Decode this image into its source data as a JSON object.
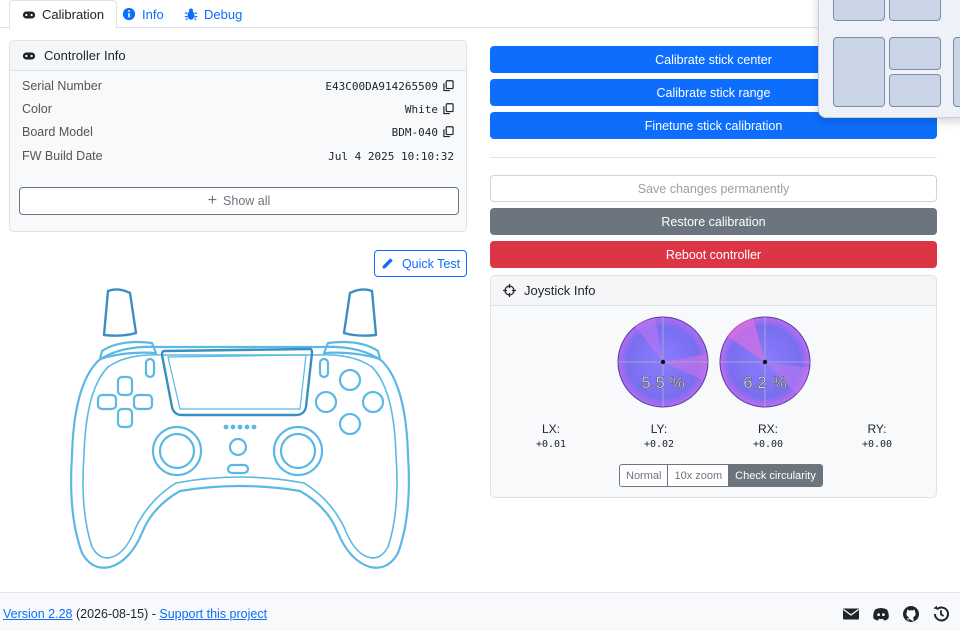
{
  "tabs": [
    {
      "label": "Calibration",
      "icon": "gamepad-icon"
    },
    {
      "label": "Info",
      "icon": "info-icon"
    },
    {
      "label": "Debug",
      "icon": "bug-icon"
    }
  ],
  "controller_info": {
    "title": "Controller Info",
    "rows": [
      {
        "label": "Serial Number",
        "value": "E43C00DA914265509",
        "copy": true
      },
      {
        "label": "Color",
        "value": "White",
        "copy": true
      },
      {
        "label": "Board Model",
        "value": "BDM-040",
        "copy": true
      },
      {
        "label": "FW Build Date",
        "value": "Jul 4 2025 10:10:32",
        "copy": false
      }
    ],
    "show_all_label": "Show all"
  },
  "quick_test_label": "Quick Test",
  "actions": {
    "calibrate_center": "Calibrate stick center",
    "calibrate_range": "Calibrate stick range",
    "finetune": "Finetune stick calibration",
    "save": "Save changes permanently",
    "restore": "Restore calibration",
    "reboot": "Reboot controller"
  },
  "joystick_info": {
    "title": "Joystick Info",
    "left_percent": "5.5 %",
    "right_percent": "6.2 %",
    "axes": [
      {
        "label": "LX:",
        "value": "+0.01"
      },
      {
        "label": "LY:",
        "value": "+0.02"
      },
      {
        "label": "RX:",
        "value": "+0.00"
      },
      {
        "label": "RY:",
        "value": "+0.00"
      }
    ],
    "modes": [
      "Normal",
      "10x zoom",
      "Check circularity"
    ],
    "active_mode": "Check circularity"
  },
  "footer": {
    "version_link": "Version 2.28",
    "date": " (2026-08-15) - ",
    "support_link": "Support this project",
    "icons": [
      "mail-icon",
      "discord-icon",
      "github-icon",
      "history-icon"
    ]
  },
  "colors": {
    "primary": "#0d6efd",
    "secondary": "#6c757d",
    "danger": "#dc3545",
    "controller_outline": "#5bb8e6"
  }
}
